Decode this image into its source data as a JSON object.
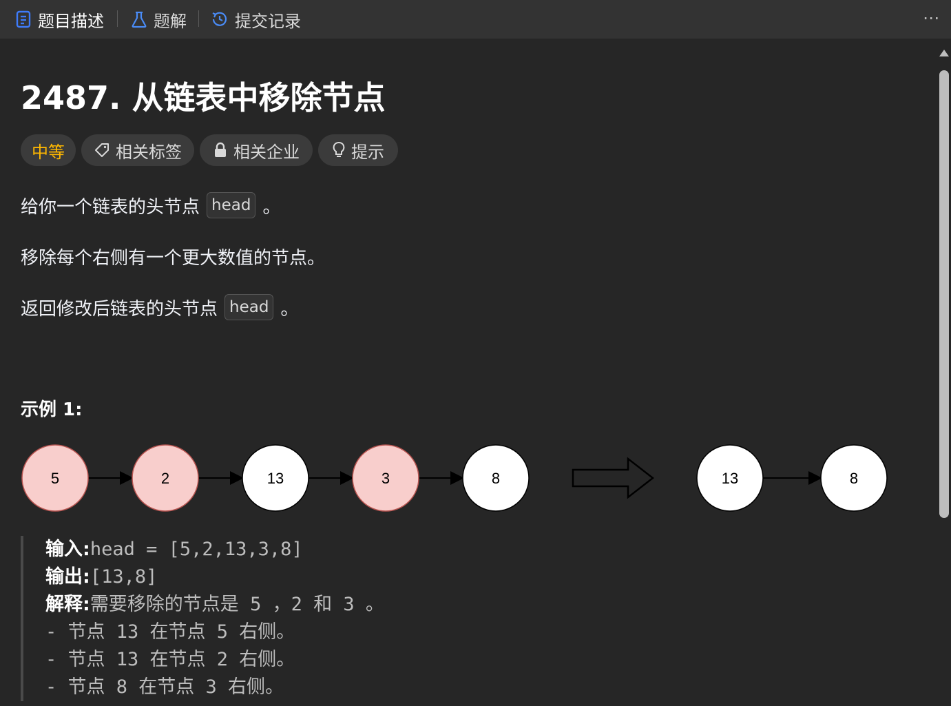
{
  "tabs": [
    {
      "label": "题目描述",
      "icon": "description-icon",
      "active": true
    },
    {
      "label": "题解",
      "icon": "flask-icon",
      "active": false
    },
    {
      "label": "提交记录",
      "icon": "history-icon",
      "active": false
    }
  ],
  "more_label": "⋯",
  "problem": {
    "title": "2487. 从链表中移除节点",
    "difficulty": "中等",
    "chips": {
      "tags": "相关标签",
      "companies": "相关企业",
      "hint": "提示"
    },
    "desc1_before": "给你一个链表的头节点",
    "desc1_code": "head",
    "desc1_after": "。",
    "desc2": "移除每个右侧有一个更大数值的节点。",
    "desc3_before": "返回修改后链表的头节点",
    "desc3_code": "head",
    "desc3_after": "。"
  },
  "example": {
    "title": "示例 1:",
    "diagram": {
      "input_nodes": [
        {
          "value": "5",
          "removed": true
        },
        {
          "value": "2",
          "removed": true
        },
        {
          "value": "13",
          "removed": false
        },
        {
          "value": "3",
          "removed": true
        },
        {
          "value": "8",
          "removed": false
        }
      ],
      "output_nodes": [
        "13",
        "8"
      ]
    },
    "input_label": "输入:",
    "input_value": "head = [5,2,13,3,8]",
    "output_label": "输出:",
    "output_value": "[13,8]",
    "explain_label": "解释:",
    "explain_text": "需要移除的节点是 5 ，2 和 3 。",
    "explain_lines": [
      "- 节点 13 在节点 5 右侧。",
      "- 节点 13 在节点 2 右侧。",
      "- 节点 8 在节点 3 右侧。"
    ]
  },
  "colors": {
    "removed_fill": "#f8cecc",
    "removed_stroke": "#b85450",
    "node_fill": "#ffffff",
    "difficulty": "#ffb800",
    "active_tab_icon": "#3e7bf9"
  }
}
